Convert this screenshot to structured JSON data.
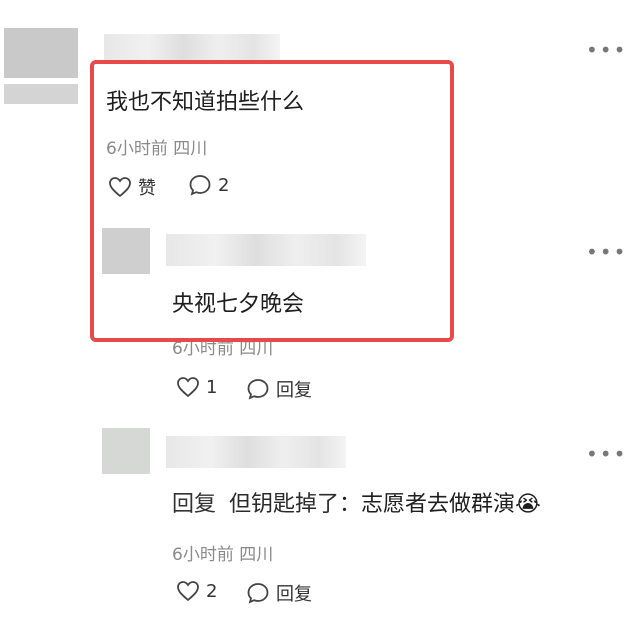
{
  "comments": [
    {
      "text": "我也不知道拍些什么",
      "meta": "6小时前 四川",
      "like_label": "赞",
      "reply_count": "2",
      "more_icon": "more-horizontal-icon"
    }
  ],
  "replies": [
    {
      "text": "央视七夕晚会",
      "meta": "6小时前 四川",
      "like_count": "1",
      "reply_label": "回复"
    },
    {
      "reply_prefix": "回复",
      "reply_target": "但钥匙掉了",
      "text_separator": "：",
      "text": "志愿者去做群演",
      "emoji": "😭",
      "meta": "6小时前 四川",
      "like_count": "2",
      "reply_label": "回复"
    }
  ],
  "colors": {
    "highlight_border": "#e84a4a",
    "meta_text": "#8a8a8a"
  }
}
